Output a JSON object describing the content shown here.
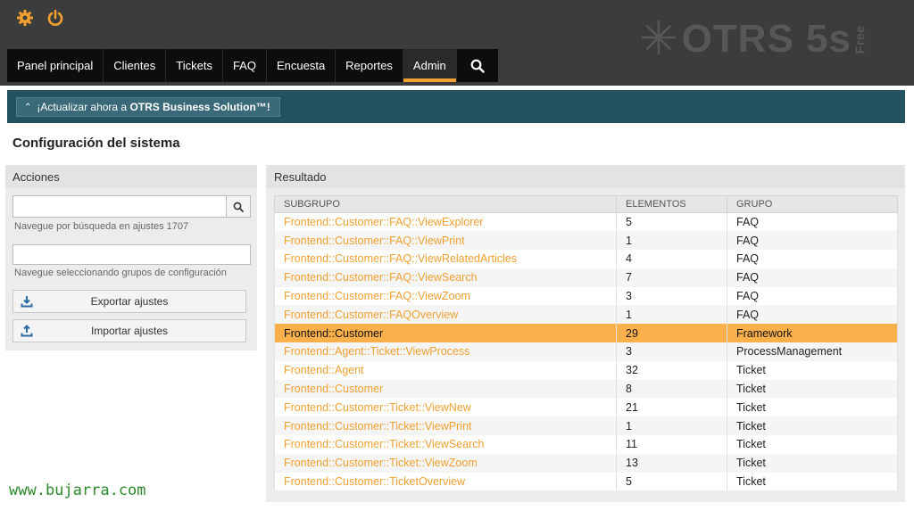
{
  "colors": {
    "accent": "#f0a030",
    "banner_bg": "#23515f",
    "header_bg": "#3c3c3c",
    "nav_bg": "#0d0d0d"
  },
  "top_icons": [
    "gear-icon",
    "power-icon"
  ],
  "logo": {
    "text": "OTRS 5s",
    "edition": "Free"
  },
  "nav": {
    "items": [
      {
        "label": "Panel principal"
      },
      {
        "label": "Clientes"
      },
      {
        "label": "Tickets"
      },
      {
        "label": "FAQ"
      },
      {
        "label": "Encuesta"
      },
      {
        "label": "Reportes"
      },
      {
        "label": "Admin",
        "active": true
      }
    ],
    "search_icon": "search-icon"
  },
  "banner": {
    "prefix": "¡Actualizar ahora a ",
    "strong": "OTRS Business Solution™!"
  },
  "page_title": "Configuración del sistema",
  "sidebar": {
    "title": "Acciones",
    "search_placeholder": "",
    "search_hint": "Navegue por búsqueda en ajustes 1707",
    "group_hint": "Navegue seleccionando grupos de configuración",
    "export_label": "Exportar ajustes",
    "import_label": "Importar ajustes"
  },
  "results": {
    "title": "Resultado",
    "columns": [
      "SUBGRUPO",
      "ELEMENTOS",
      "GRUPO"
    ],
    "rows": [
      {
        "subgroup": "Frontend::Customer::FAQ::ViewExplorer",
        "elements": "5",
        "group": "FAQ"
      },
      {
        "subgroup": "Frontend::Customer::FAQ::ViewPrint",
        "elements": "1",
        "group": "FAQ"
      },
      {
        "subgroup": "Frontend::Customer::FAQ::ViewRelatedArticles",
        "elements": "4",
        "group": "FAQ"
      },
      {
        "subgroup": "Frontend::Customer::FAQ::ViewSearch",
        "elements": "7",
        "group": "FAQ"
      },
      {
        "subgroup": "Frontend::Customer::FAQ::ViewZoom",
        "elements": "3",
        "group": "FAQ"
      },
      {
        "subgroup": "Frontend::Customer::FAQOverview",
        "elements": "1",
        "group": "FAQ"
      },
      {
        "subgroup": "Frontend::Customer",
        "elements": "29",
        "group": "Framework",
        "selected": true
      },
      {
        "subgroup": "Frontend::Agent::Ticket::ViewProcess",
        "elements": "3",
        "group": "ProcessManagement"
      },
      {
        "subgroup": "Frontend::Agent",
        "elements": "32",
        "group": "Ticket"
      },
      {
        "subgroup": "Frontend::Customer",
        "elements": "8",
        "group": "Ticket"
      },
      {
        "subgroup": "Frontend::Customer::Ticket::ViewNew",
        "elements": "21",
        "group": "Ticket"
      },
      {
        "subgroup": "Frontend::Customer::Ticket::ViewPrint",
        "elements": "1",
        "group": "Ticket"
      },
      {
        "subgroup": "Frontend::Customer::Ticket::ViewSearch",
        "elements": "11",
        "group": "Ticket"
      },
      {
        "subgroup": "Frontend::Customer::Ticket::ViewZoom",
        "elements": "13",
        "group": "Ticket"
      },
      {
        "subgroup": "Frontend::Customer::TicketOverview",
        "elements": "5",
        "group": "Ticket"
      }
    ]
  },
  "watermark": "www.bujarra.com"
}
